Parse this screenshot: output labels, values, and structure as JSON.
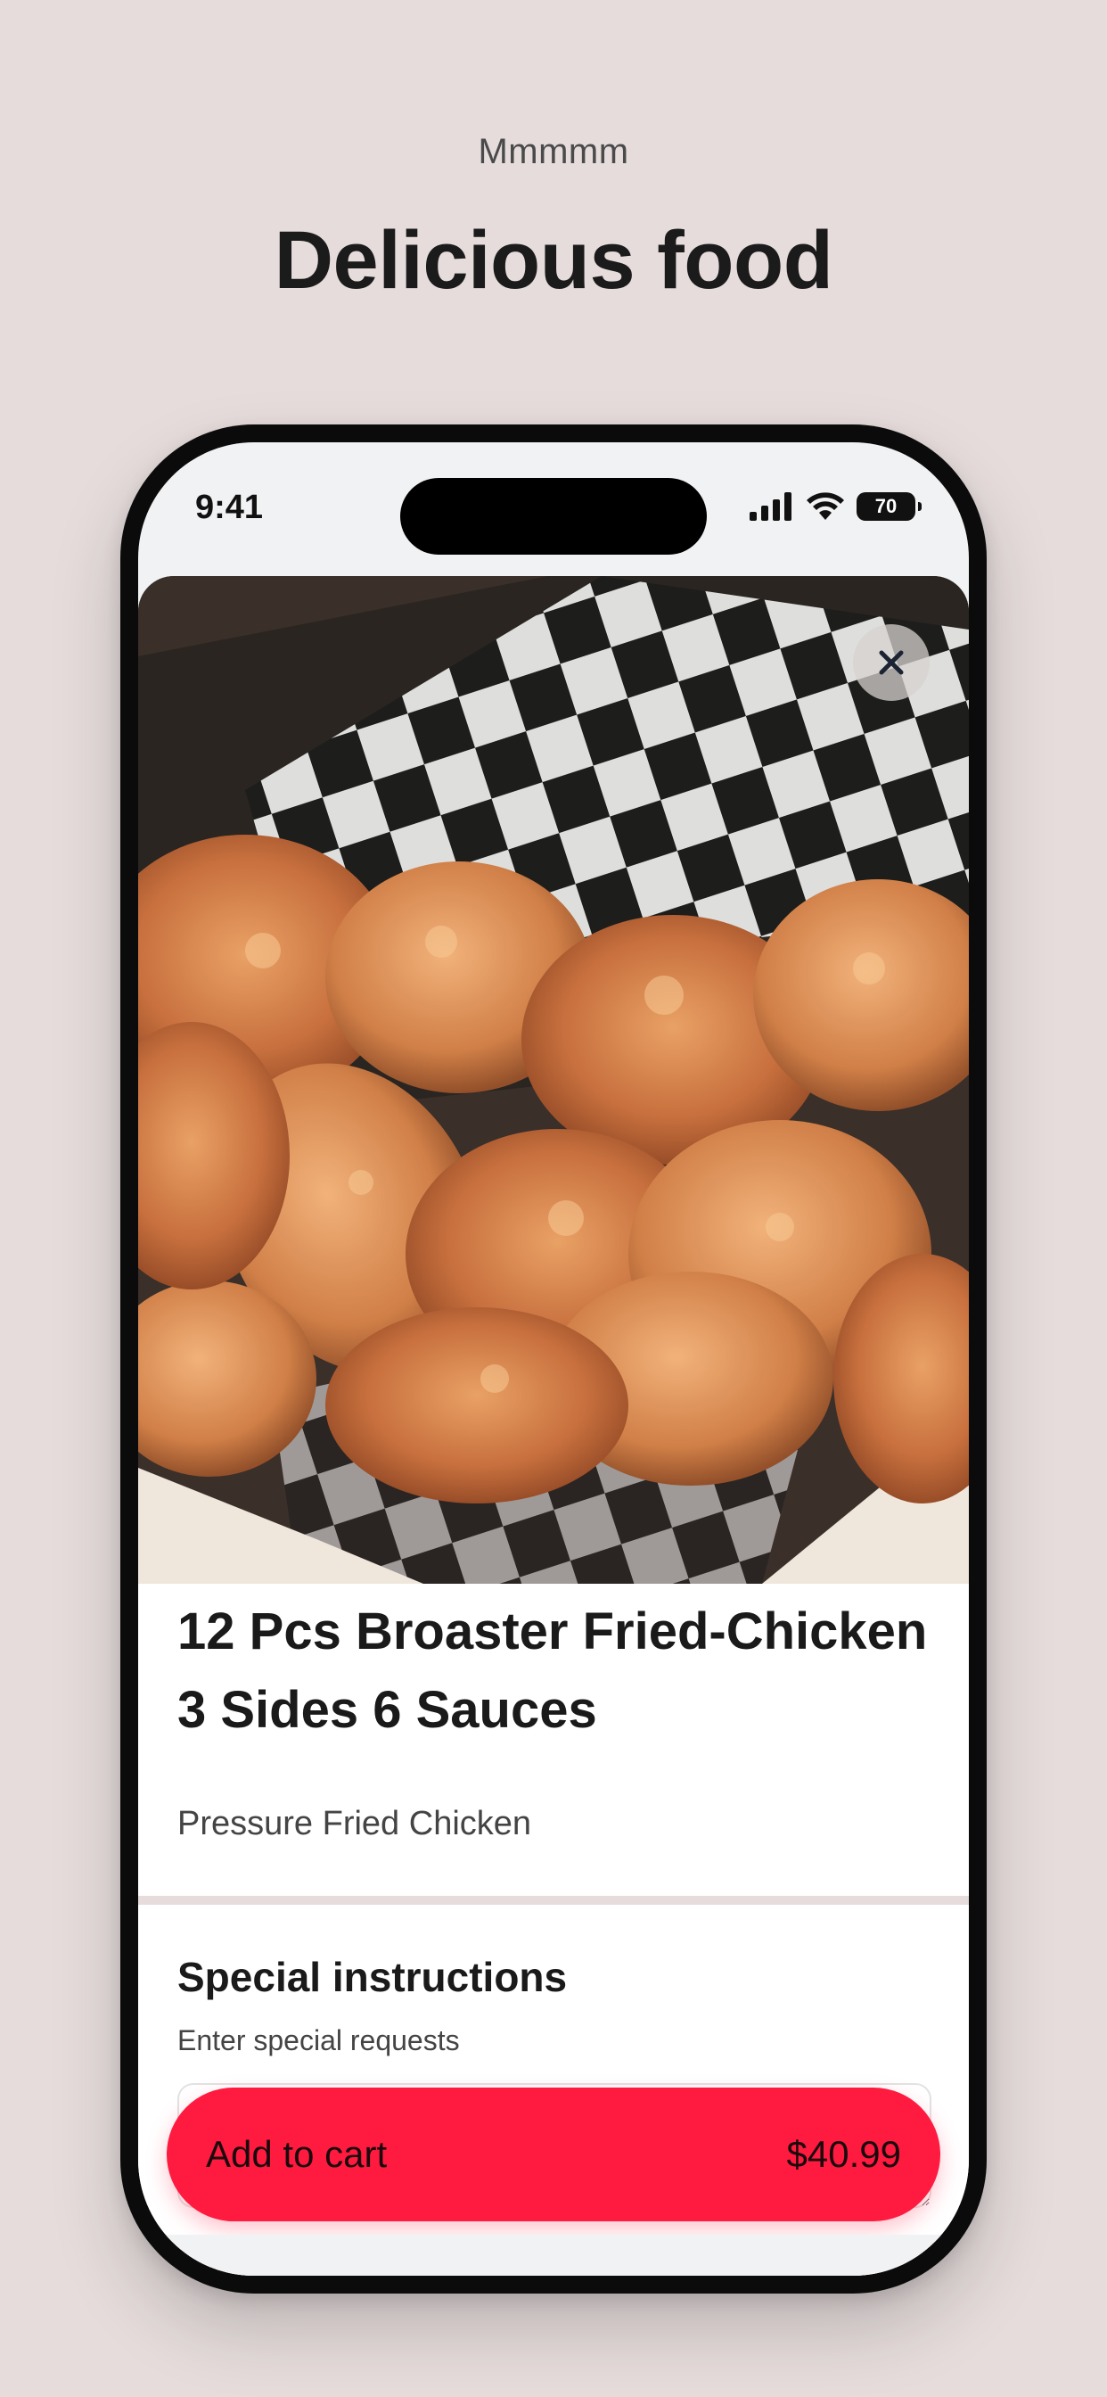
{
  "hero": {
    "eyebrow": "Mmmmm",
    "title": "Delicious food"
  },
  "status_bar": {
    "time": "9:41",
    "battery": "70",
    "icons": [
      "signal-icon",
      "wifi-icon",
      "battery-icon"
    ]
  },
  "item": {
    "image_icon": "fried-chicken-photo",
    "title": "12 Pcs Broaster Fried-Chicken 3 Sides 6 Sauces",
    "subtitle": "Pressure Fried Chicken"
  },
  "instructions": {
    "title": "Special instructions",
    "hint": "Enter special requests",
    "value": ""
  },
  "cart": {
    "label": "Add to cart",
    "price": "$40.99"
  },
  "colors": {
    "background": "#e6dcdc",
    "accent": "#ff1a3f"
  }
}
